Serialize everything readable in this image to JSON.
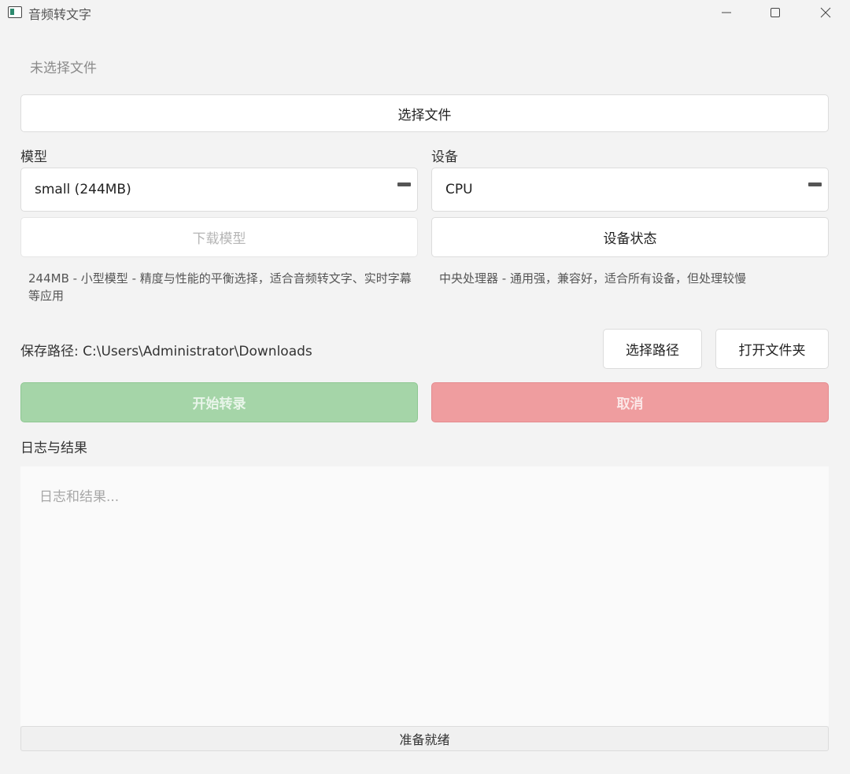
{
  "window": {
    "title": "音频转文字"
  },
  "file": {
    "status": "未选择文件",
    "choose_label": "选择文件"
  },
  "model": {
    "label": "模型",
    "selected": "small (244MB)",
    "download_label": "下载模型",
    "description": "244MB - 小型模型 - 精度与性能的平衡选择，适合音频转文字、实时字幕等应用"
  },
  "device": {
    "label": "设备",
    "selected": "CPU",
    "status_label": "设备状态",
    "description": "中央处理器 - 通用强，兼容好，适合所有设备，但处理较慢"
  },
  "save": {
    "path_text": "保存路径: C:\\Users\\Administrator\\Downloads",
    "choose_path_label": "选择路径",
    "open_folder_label": "打开文件夹"
  },
  "actions": {
    "start_label": "开始转录",
    "cancel_label": "取消"
  },
  "log": {
    "label": "日志与结果",
    "placeholder": "日志和结果..."
  },
  "status": {
    "text": "准备就绪"
  },
  "colors": {
    "start_button": "#a5d5a8",
    "cancel_button": "#ef9d9f",
    "background": "#f3f3f3"
  },
  "icons": {
    "app": "app-window-icon",
    "minimize": "minimize-icon",
    "maximize": "maximize-icon",
    "close": "close-icon",
    "combo_arrow": "dropdown-dash-icon"
  }
}
